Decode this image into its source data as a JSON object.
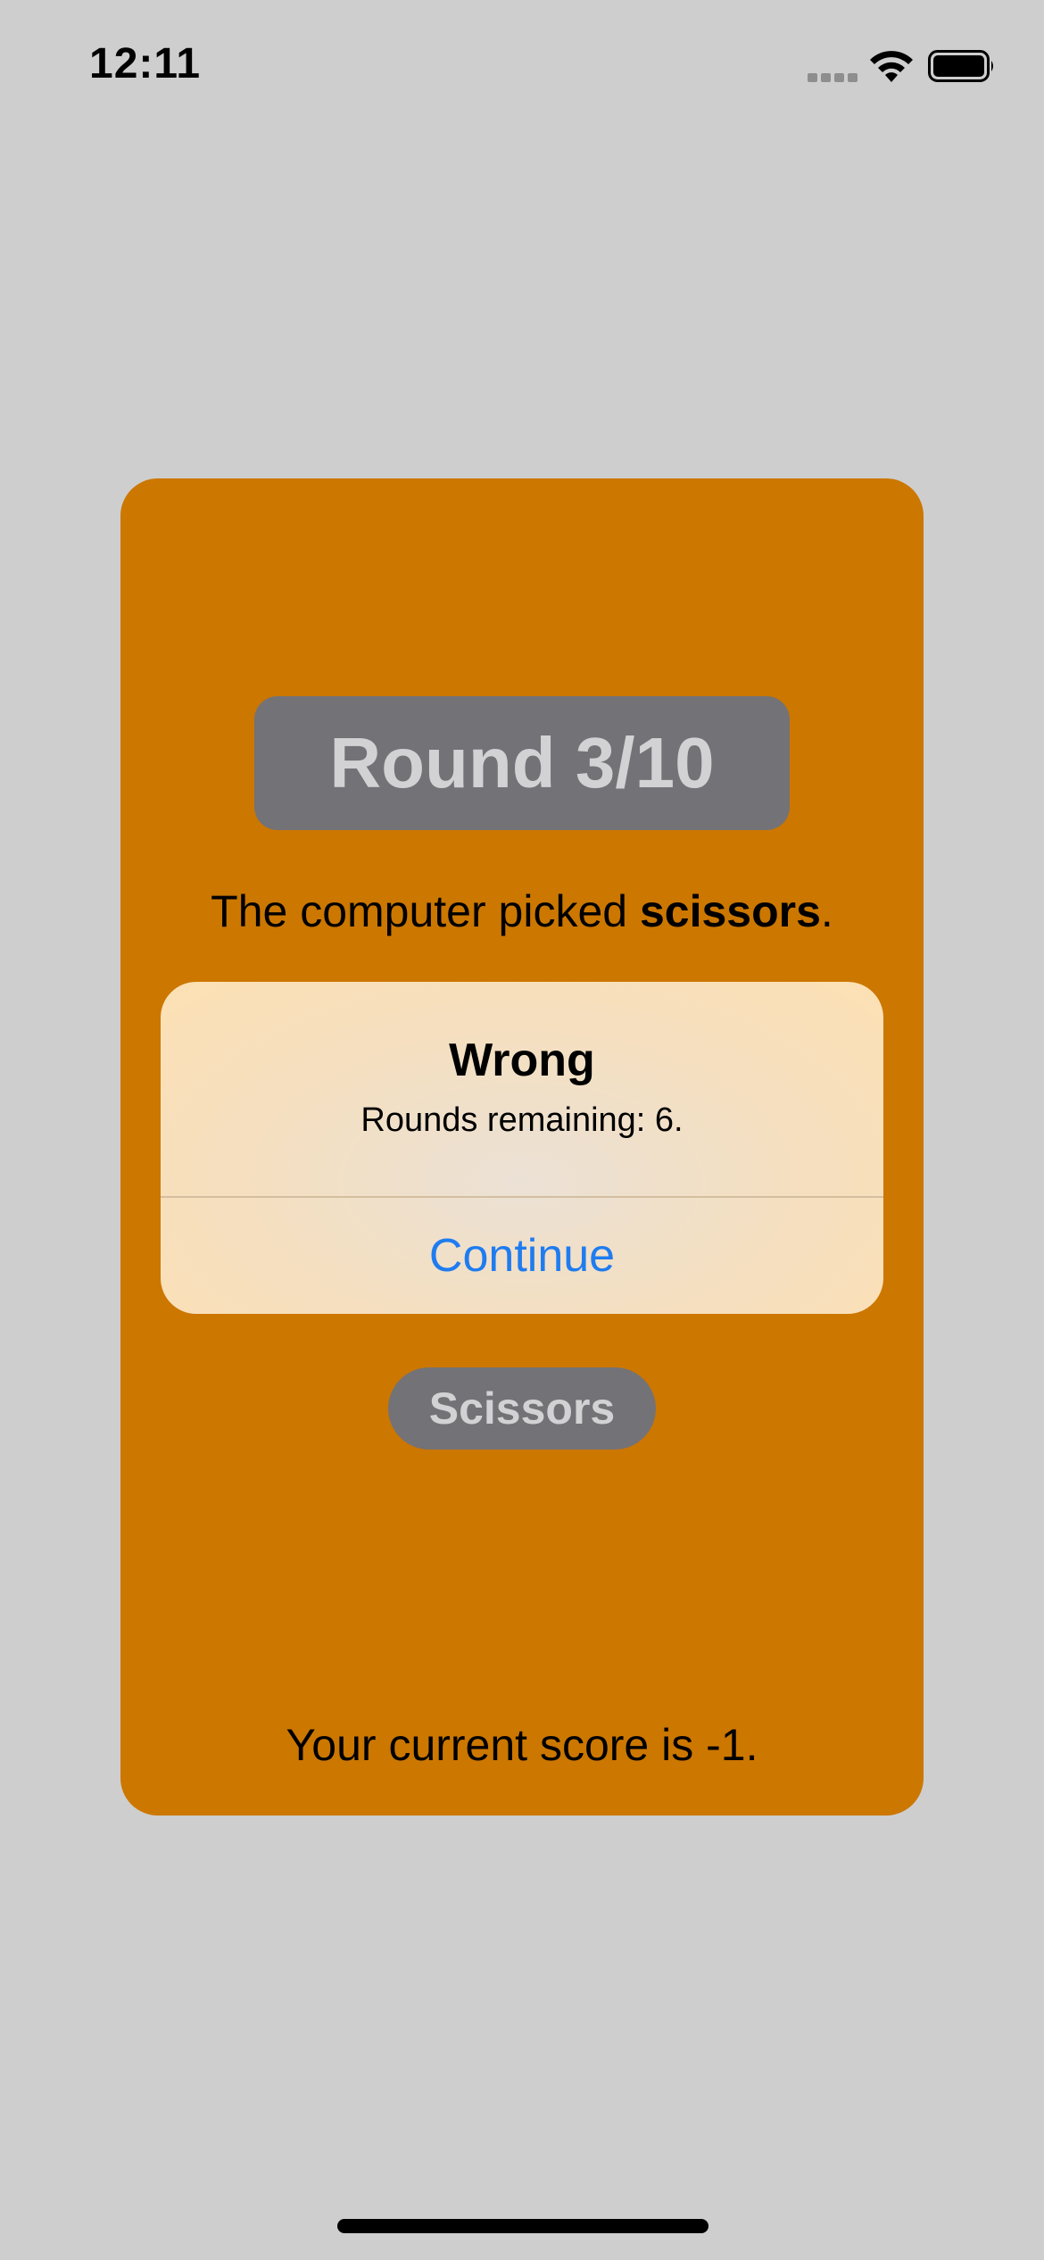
{
  "status_bar": {
    "time": "12:11"
  },
  "game": {
    "round_label": "Round 3/10",
    "picked_prefix": "The computer picked ",
    "picked_choice": "scissors",
    "picked_suffix": ".",
    "score_text": "Your current score is -1."
  },
  "alert": {
    "title": "Wrong",
    "message": "Rounds remaining: 6.",
    "button_label": "Continue"
  },
  "choice_button": {
    "label": "Scissors"
  },
  "colors": {
    "background": "#cecece",
    "card": "#cc7700",
    "pill": "#737277",
    "pill_text": "#d2d2d4",
    "alert_button": "#1f7cf0"
  },
  "icons": {
    "signal": "cellular-signal-icon",
    "wifi": "wifi-icon",
    "battery": "battery-icon"
  }
}
